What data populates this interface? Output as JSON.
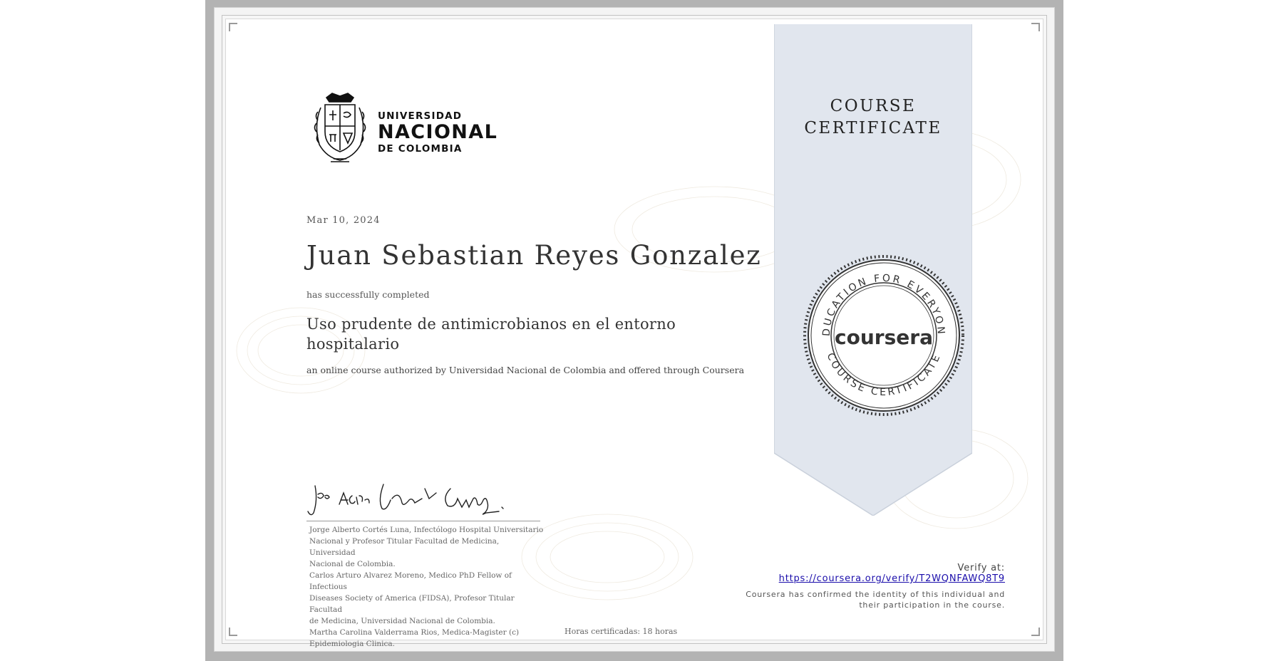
{
  "university": {
    "line1": "UNIVERSIDAD",
    "line2": "NACIONAL",
    "line3": "DE COLOMBIA"
  },
  "certificate": {
    "date": "Mar 10, 2024",
    "recipient": "Juan Sebastian Reyes Gonzalez",
    "completed_text": "has successfully completed",
    "course_title": "Uso prudente de antimicrobianos en el entorno hospitalario",
    "authorized_text": "an online course authorized by Universidad Nacional de Colombia and offered through Coursera",
    "hours": "Horas certificadas: 18 horas"
  },
  "ribbon": {
    "line1": "COURSE",
    "line2": "CERTIFICATE"
  },
  "seal": {
    "brand": "coursera",
    "ring_top": "EDUCATION FOR EVERYONE",
    "ring_bottom": "COURSE CERTIFICATE"
  },
  "signers": [
    "Jorge Alberto Cortés Luna, Infectólogo Hospital Universitario",
    "Nacional y Profesor Titular Facultad de Medicina, Universidad",
    "Nacional de Colombia.",
    "Carlos Arturo Alvarez Moreno, Medico PhD Fellow of Infectious",
    "Diseases Society of America (FIDSA), Profesor Titular Facultad",
    "de Medicina, Universidad Nacional de Colombia.",
    "Martha Carolina Valderrama Rios, Medica-Magister (c)",
    "Epidemiologia Clinica."
  ],
  "verify": {
    "label": "Verify at:",
    "url": "https://coursera.org/verify/T2WQNFAWQ8T9",
    "note": "Coursera has confirmed the identity of this individual and their participation in the course."
  },
  "colors": {
    "ribbon_fill": "#e1e6ee",
    "frame_gray": "#b3b3b3",
    "link_blue": "#1a0dab",
    "seal_dark": "#333333"
  }
}
